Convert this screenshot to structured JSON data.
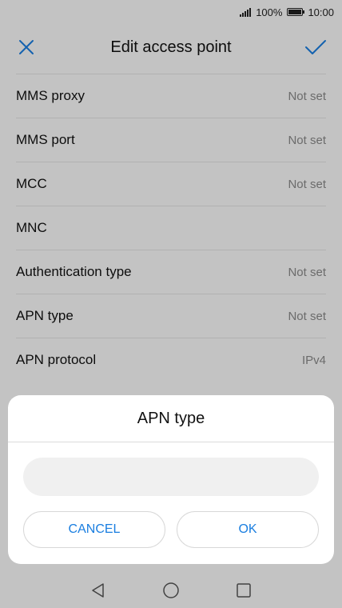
{
  "status_bar": {
    "battery_percent": "100%",
    "time": "10:00"
  },
  "header": {
    "title": "Edit access point",
    "close_icon": "close-icon",
    "confirm_icon": "check-icon"
  },
  "settings": [
    {
      "label": "MMS proxy",
      "value": "Not set"
    },
    {
      "label": "MMS port",
      "value": "Not set"
    },
    {
      "label": "MCC",
      "value": "Not set"
    },
    {
      "label": "MNC",
      "value": ""
    },
    {
      "label": "Authentication type",
      "value": "Not set"
    },
    {
      "label": "APN type",
      "value": "Not set"
    },
    {
      "label": "APN protocol",
      "value": "IPv4"
    }
  ],
  "dialog": {
    "title": "APN type",
    "input_value": "",
    "cancel_label": "CANCEL",
    "ok_label": "OK"
  },
  "nav_bar": {
    "icons": [
      "back-icon",
      "home-icon",
      "recents-icon"
    ]
  },
  "colors": {
    "accent": "#1a7ee0"
  }
}
